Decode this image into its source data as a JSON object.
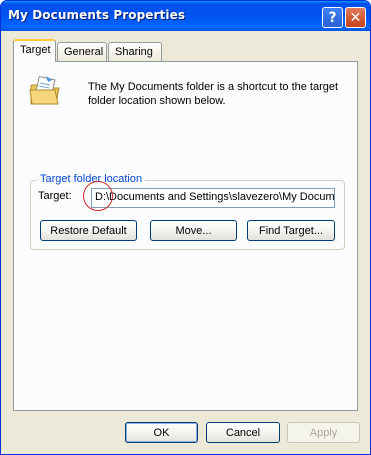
{
  "window": {
    "title": "My Documents Properties",
    "help_icon": "question-mark-icon",
    "close_icon": "close-x-icon"
  },
  "tabs": [
    {
      "label": "Target",
      "active": true
    },
    {
      "label": "General",
      "active": false
    },
    {
      "label": "Sharing",
      "active": false
    }
  ],
  "target_tab": {
    "icon": "documents-folder-icon",
    "description": "The My Documents folder is a shortcut to the target folder location shown below.",
    "group_label": "Target folder location",
    "target_label": "Target:",
    "target_value": "D:\\Documents and Settings\\slavezero\\My Documents",
    "buttons": {
      "restore_default": "Restore Default",
      "move": "Move...",
      "find_target": "Find Target..."
    }
  },
  "footer": {
    "ok": "OK",
    "cancel": "Cancel",
    "apply": "Apply",
    "apply_enabled": false
  },
  "colors": {
    "titlebar": "#0050ee",
    "group_label": "#0046d5",
    "annotation_circle": "#cc2a2a"
  }
}
